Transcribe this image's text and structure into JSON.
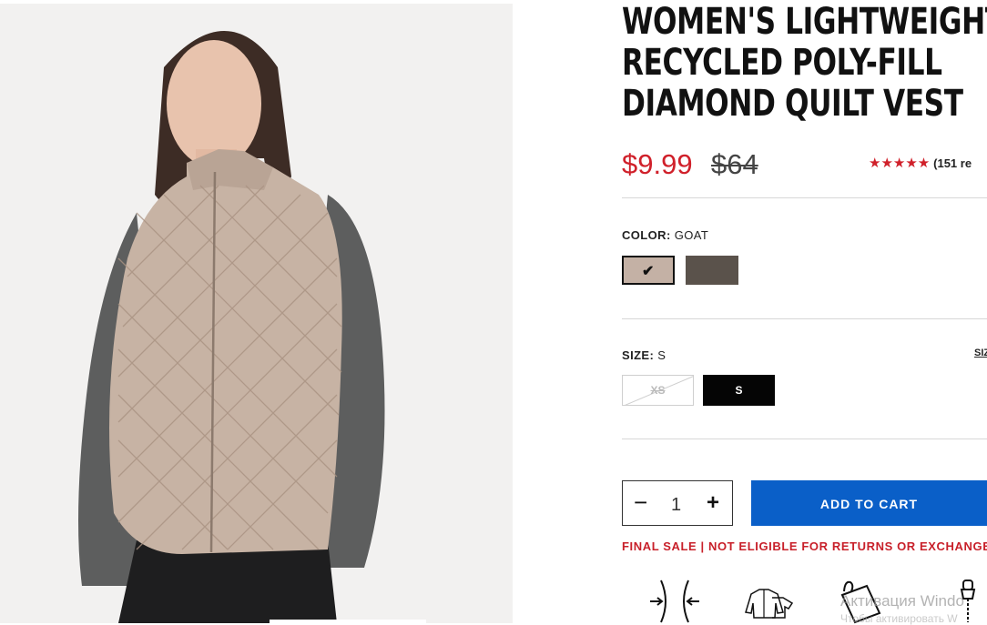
{
  "product": {
    "title_lines": [
      "WOMEN'S LIGHTWEIGHT",
      "RECYCLED POLY-FILL",
      "DIAMOND QUILT VEST"
    ],
    "price": "$9.99",
    "original_price": "$64",
    "rating_stars": "★★★★★",
    "reviews_text": "(151 re"
  },
  "color": {
    "label": "COLOR:",
    "selected": "GOAT",
    "swatches": [
      {
        "name": "Goat",
        "hex": "#c4b1a5",
        "selected": true
      },
      {
        "name": "Dark",
        "hex": "#5a524b",
        "selected": false
      }
    ],
    "check_glyph": "✔"
  },
  "size": {
    "label": "SIZE:",
    "selected": "S",
    "guide_text": "SIZ",
    "options": [
      {
        "label": "XS",
        "available": false
      },
      {
        "label": "S",
        "available": true,
        "selected": true
      }
    ]
  },
  "cart": {
    "minus": "−",
    "quantity": "1",
    "plus": "+",
    "add_label": "ADD TO CART"
  },
  "notice": "FINAL SALE | NOT ELIGIBLE FOR RETURNS OR EXCHANGE",
  "feature_icons": [
    "fit-arrows-icon",
    "layering-jacket-icon",
    "packable-pouch-icon",
    "zipper-icon"
  ],
  "watermark": {
    "line1": "Активация Windo",
    "line2": "Чтобы активировать W"
  },
  "colors": {
    "sale_red": "#d0202a",
    "cart_blue": "#0a5fc8",
    "vest": "#c4b1a5"
  }
}
